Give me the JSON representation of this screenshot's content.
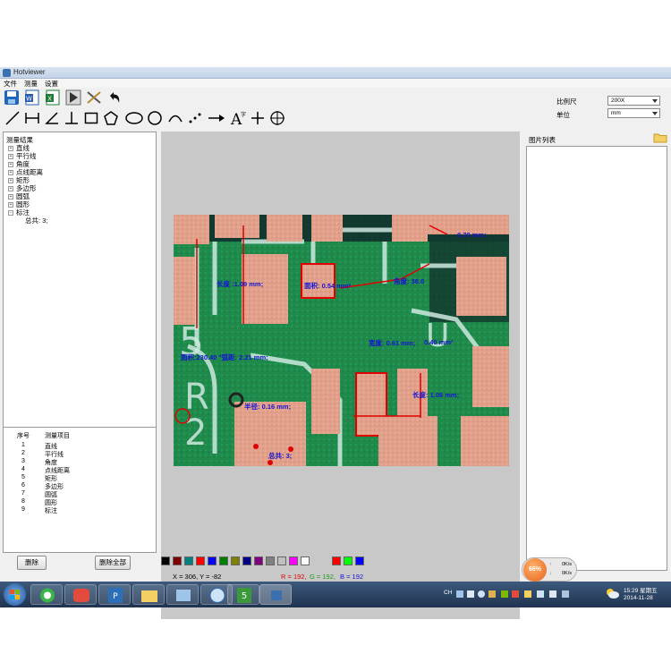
{
  "window": {
    "title": "Hotviewer"
  },
  "menu": {
    "file": "文件",
    "measure": "测量",
    "settings": "设置"
  },
  "scale": {
    "label": "比例尺",
    "value": "200X"
  },
  "unit": {
    "label": "单位",
    "value": "mm"
  },
  "tree": {
    "root": "测量结果",
    "items": [
      "直线",
      "平行线",
      "角度",
      "点线距离",
      "矩形",
      "多边形",
      "圆弧",
      "圆形",
      "标注"
    ],
    "expanded_child": "总共: 3;"
  },
  "list": {
    "headers": {
      "index": "序号",
      "item": "测量项目"
    },
    "rows": [
      {
        "n": "1",
        "name": "直线"
      },
      {
        "n": "2",
        "name": "平行线"
      },
      {
        "n": "3",
        "name": "角度"
      },
      {
        "n": "4",
        "name": "点线距离"
      },
      {
        "n": "5",
        "name": "矩形"
      },
      {
        "n": "6",
        "name": "多边形"
      },
      {
        "n": "7",
        "name": "圆弧"
      },
      {
        "n": "8",
        "name": "圆形"
      },
      {
        "n": "9",
        "name": "标注"
      }
    ]
  },
  "buttons": {
    "delete": "删除",
    "delete_all": "删除全部"
  },
  "right_panel": {
    "title": "图片列表"
  },
  "status": {
    "coords": "X = 306, Y = -82",
    "r": "R = 192,",
    "g": "G = 192,",
    "b": "B = 192"
  },
  "palette": [
    "#000000",
    "#800000",
    "#008080",
    "#ff0000",
    "#0000ff",
    "#008000",
    "#808000",
    "#000080",
    "#800080",
    "#808080",
    "#c0c0c0",
    "#ff00ff",
    "#ffffff",
    "#ff0000",
    "#00ff00",
    "#0000ff"
  ],
  "measurements": {
    "m1": "长度 :1.09 mm;",
    "m2": "面积: 0.54 mm²",
    "m3": "角度: 38.0",
    "m4": "0.70 mm;",
    "m5": "宽度: 0.61 mm;",
    "m6": "面积:230.40 °弧距: 2.21 mm;",
    "m7": "长度: 1.06 mm;",
    "m8": "半径: 0.16 mm;",
    "m9": "总共: 3;",
    "m10": "0.40 mm²"
  },
  "network": {
    "percent": "66%",
    "up": "0K/s",
    "down": "0K/s"
  },
  "clock": {
    "time": "15:29 星期五",
    "date": "2014-11-28"
  },
  "tray": {
    "lang": "CH"
  },
  "colors": {
    "label_blue": "#1414d4",
    "measure_red": "#e00000",
    "board_green": "#2e8b57"
  }
}
